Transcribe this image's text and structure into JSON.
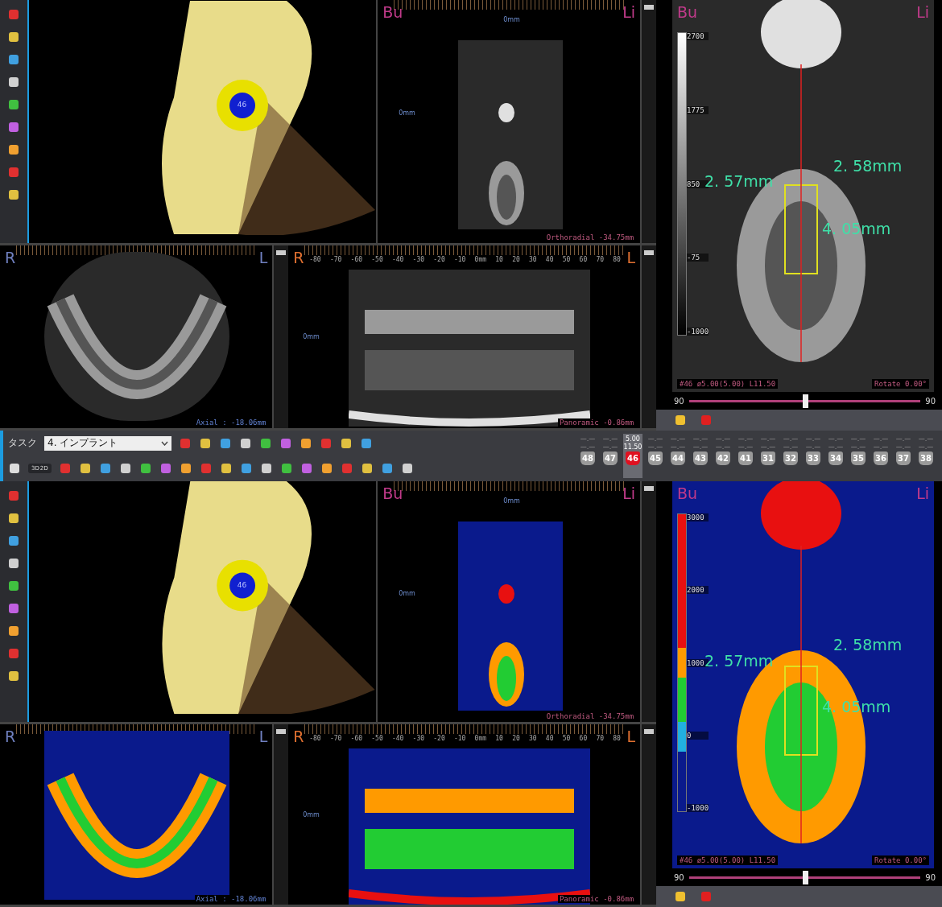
{
  "views": [
    {
      "kind": "grayscale",
      "model_tooth": "46",
      "ortho": {
        "left": "Bu",
        "right": "Li",
        "top_mark": "0mm",
        "side_mark": "0mm",
        "caption": "Orthoradial -34.75mm"
      },
      "axial": {
        "left": "R",
        "right": "L",
        "caption": "Axial : -18.06mm"
      },
      "panoramic": {
        "left": "R",
        "right": "L",
        "ruler": [
          "-80",
          "-70",
          "-60",
          "-50",
          "-40",
          "-30",
          "-20",
          "-10",
          "0mm",
          "10",
          "20",
          "30",
          "40",
          "50",
          "60",
          "70",
          "80"
        ],
        "side_mark": "0mm",
        "caption": "Panoramic -0.86mm"
      },
      "cross": {
        "left": "Bu",
        "right": "Li",
        "scale": [
          "2700",
          "1775",
          "850",
          "-75",
          "-1000"
        ],
        "measurements": [
          "2. 57mm",
          "2. 58mm",
          "4. 05mm"
        ],
        "info": "#46 ø5.00(5.00) L11.50",
        "rotate": "Rotate 0.00°",
        "slider_min": "90",
        "slider_max": "90",
        "level": 0.5
      }
    },
    {
      "kind": "density",
      "model_tooth": "46",
      "ortho": {
        "left": "Bu",
        "right": "Li",
        "top_mark": "0mm",
        "side_mark": "0mm",
        "caption": "Orthoradial -34.75mm"
      },
      "axial": {
        "left": "R",
        "right": "L",
        "caption": "Axial : -18.06mm"
      },
      "panoramic": {
        "left": "R",
        "right": "L",
        "ruler": [
          "-80",
          "-70",
          "-60",
          "-50",
          "-40",
          "-30",
          "-20",
          "-10",
          "0mm",
          "10",
          "20",
          "30",
          "40",
          "50",
          "60",
          "70",
          "80"
        ],
        "side_mark": "0mm",
        "caption": "Panoramic -0.86mm"
      },
      "cross": {
        "left": "Bu",
        "right": "Li",
        "scale": [
          "3000",
          "2000",
          "1000",
          "0",
          "-1000"
        ],
        "measurements": [
          "2. 57mm",
          "2. 58mm",
          "4. 05mm"
        ],
        "info": "#46 ø5.00(5.00) L11.50",
        "rotate": "Rotate 0.00°",
        "slider_min": "90",
        "slider_max": "90",
        "level": 0.5
      }
    }
  ],
  "toolbar": {
    "task_label": "タスク",
    "task_value": "4. インプラント",
    "view_toggle": [
      "3D",
      "2D"
    ]
  },
  "tooth_selector": [
    {
      "number": "48",
      "selected": false,
      "diameter": "—.—",
      "length": "—.—"
    },
    {
      "number": "47",
      "selected": false,
      "diameter": "—.—",
      "length": "—.—"
    },
    {
      "number": "46",
      "selected": true,
      "diameter": "5.00",
      "length": "11.50"
    },
    {
      "number": "45",
      "selected": false,
      "diameter": "—.—",
      "length": "—.—"
    },
    {
      "number": "44",
      "selected": false,
      "diameter": "—.—",
      "length": "—.—"
    },
    {
      "number": "43",
      "selected": false,
      "diameter": "—.—",
      "length": "—.—"
    },
    {
      "number": "42",
      "selected": false,
      "diameter": "—.—",
      "length": "—.—"
    },
    {
      "number": "41",
      "selected": false,
      "diameter": "—.—",
      "length": "—.—"
    },
    {
      "number": "31",
      "selected": false,
      "diameter": "—.—",
      "length": "—.—"
    },
    {
      "number": "32",
      "selected": false,
      "diameter": "—.—",
      "length": "—.—"
    },
    {
      "number": "33",
      "selected": false,
      "diameter": "—.—",
      "length": "—.—"
    },
    {
      "number": "34",
      "selected": false,
      "diameter": "—.—",
      "length": "—.—"
    },
    {
      "number": "35",
      "selected": false,
      "diameter": "—.—",
      "length": "—.—"
    },
    {
      "number": "36",
      "selected": false,
      "diameter": "—.—",
      "length": "—.—"
    },
    {
      "number": "37",
      "selected": false,
      "diameter": "—.—",
      "length": "—.—"
    },
    {
      "number": "38",
      "selected": false,
      "diameter": "—.—",
      "length": "—.—"
    }
  ]
}
